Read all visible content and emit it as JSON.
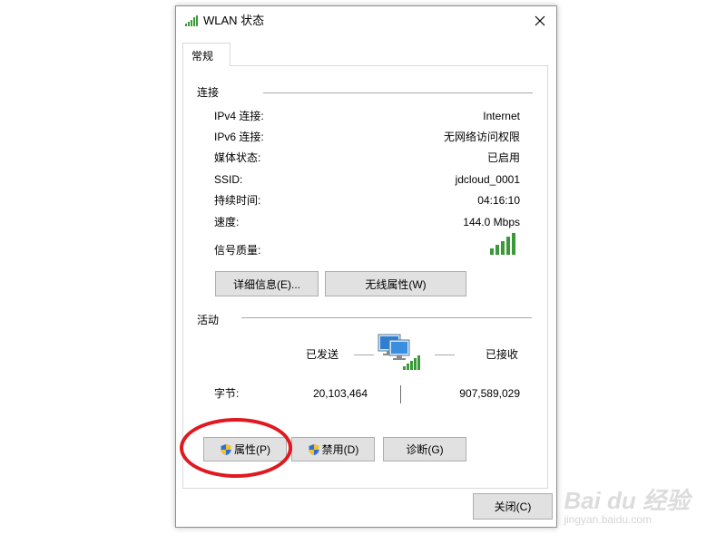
{
  "window": {
    "title": "WLAN 状态",
    "icon": "wlan-signal-icon",
    "close_icon": "close-icon"
  },
  "tabs": [
    {
      "label": "常规"
    }
  ],
  "connection": {
    "heading": "连接",
    "rows": [
      {
        "label": "IPv4 连接:",
        "value": "Internet"
      },
      {
        "label": "IPv6 连接:",
        "value": "无网络访问权限"
      },
      {
        "label": "媒体状态:",
        "value": "已启用"
      },
      {
        "label": "SSID:",
        "value": "jdcloud_0001"
      },
      {
        "label": "持续时间:",
        "value": "04:16:10"
      },
      {
        "label": "速度:",
        "value": "144.0 Mbps"
      }
    ],
    "signal_label": "信号质量:",
    "signal_bars": 5,
    "details_button": "详细信息(E)...",
    "wireless_props_button": "无线属性(W)"
  },
  "activity": {
    "heading": "活动",
    "sent_label": "已发送",
    "received_label": "已接收",
    "bytes_label": "字节:",
    "bytes_sent": "20,103,464",
    "bytes_received": "907,589,029"
  },
  "buttons": {
    "properties": "属性(P)",
    "disable": "禁用(D)",
    "diagnose": "诊断(G)",
    "close": "关闭(C)"
  },
  "colors": {
    "signal_green": "#3a9a3a",
    "highlight_red": "#e0181f"
  },
  "watermark": {
    "brand": "Bai du 经验",
    "url": "jingyan.baidu.com"
  }
}
